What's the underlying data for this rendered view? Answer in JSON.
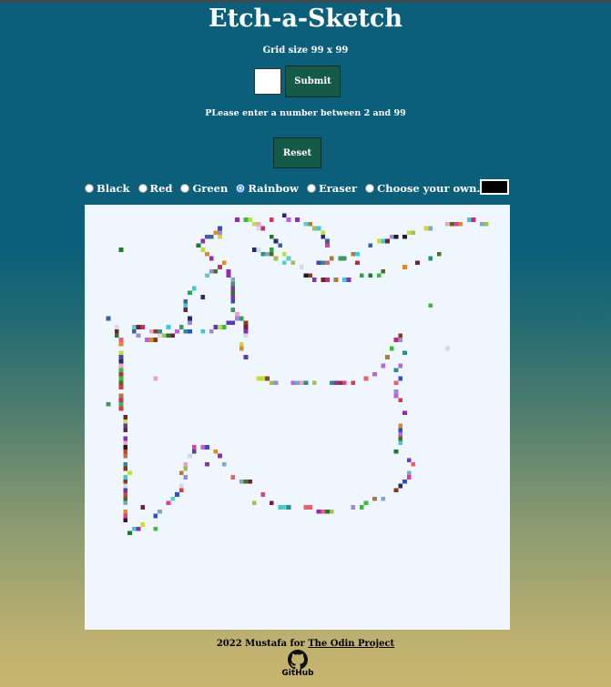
{
  "page": {
    "title": "Etch-a-Sketch",
    "grid_size_text": "Grid size 99 x 99",
    "size_input_value": "",
    "submit_label": "Submit",
    "hint": "PLease enter a number between 2 and 99",
    "reset_label": "Reset"
  },
  "modes": [
    {
      "label": "Black",
      "checked": false
    },
    {
      "label": "Red",
      "checked": false
    },
    {
      "label": "Green",
      "checked": false
    },
    {
      "label": "Rainbow",
      "checked": true
    },
    {
      "label": "Eraser",
      "checked": false
    },
    {
      "label": "Choose your own...",
      "checked": false
    }
  ],
  "custom_color": "#000000",
  "grid": {
    "cells": 99,
    "background": "#eff6fe",
    "palette": [
      "#8b2fb0",
      "#c22f6a",
      "#1e7a2e",
      "#4a6e22",
      "#2a2a6a",
      "#d6d638",
      "#3fc9d8",
      "#e23c98",
      "#3a9a5a",
      "#9b8ad8",
      "#6c2238",
      "#b07a3a",
      "#1e1e1e",
      "#d8384a",
      "#57d0c8",
      "#7aa8c8",
      "#a0c050",
      "#e08828",
      "#3050c8",
      "#c060e0",
      "#5a3ab0",
      "#d8d8e8",
      "#e86070",
      "#40b840",
      "#883a20",
      "#2b8e8e",
      "#b8e040",
      "#f0a0c0",
      "#4060a0",
      "#a03a3a"
    ],
    "filled_count": 263
  },
  "footer": {
    "text": "2022 Mustafa for ",
    "link_label": "The Odin Project",
    "github_label": "GitHub"
  },
  "colors": {
    "button_bg": "#155a47",
    "gradient_top": "#0b5f7a",
    "gradient_bottom": "#c8b66f"
  }
}
